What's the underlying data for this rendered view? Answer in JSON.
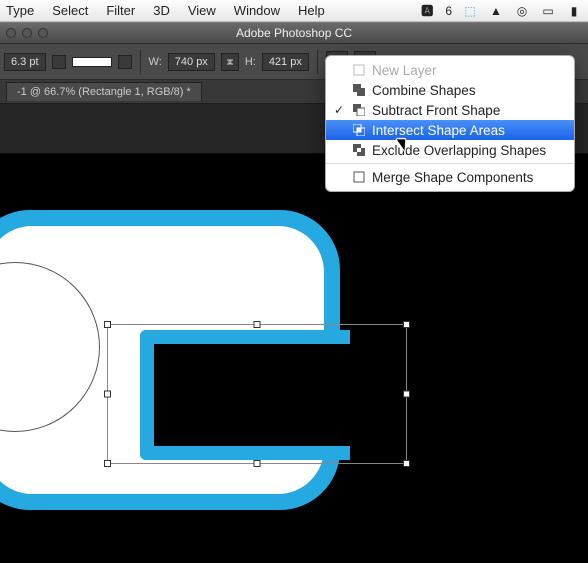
{
  "mac_menu": {
    "items": [
      "Type",
      "Select",
      "Filter",
      "3D",
      "View",
      "Window",
      "Help"
    ],
    "tray": {
      "notif_count": "6"
    }
  },
  "titlebar": {
    "title": "Adobe Photoshop CC"
  },
  "options": {
    "stroke_width": "6.3 pt",
    "w_label": "W:",
    "w_value": "740 px",
    "h_label": "H:",
    "h_value": "421 px"
  },
  "doc_tab": {
    "label": "-1 @ 66.7% (Rectangle 1, RGB/8) *"
  },
  "dropdown": {
    "items": [
      {
        "label": "New Layer",
        "disabled": true,
        "checked": false
      },
      {
        "label": "Combine Shapes",
        "disabled": false,
        "checked": false
      },
      {
        "label": "Subtract Front Shape",
        "disabled": false,
        "checked": true
      },
      {
        "label": "Intersect Shape Areas",
        "disabled": false,
        "checked": false,
        "selected": true
      },
      {
        "label": "Exclude Overlapping Shapes",
        "disabled": false,
        "checked": false
      }
    ],
    "footer": {
      "label": "Merge Shape Components"
    }
  }
}
